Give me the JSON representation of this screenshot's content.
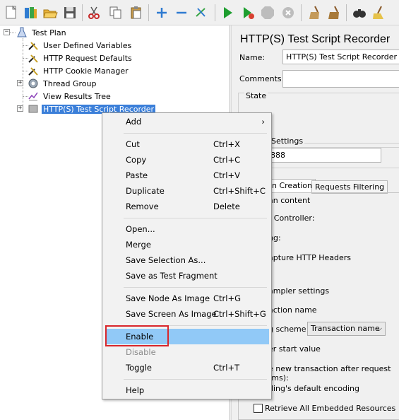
{
  "toolbar": {
    "buttons": [
      "new-icon",
      "templates-icon",
      "open-icon",
      "save-icon",
      "cut-icon",
      "copy-icon",
      "paste-icon",
      "expand-icon",
      "collapse-icon",
      "toggle-icon",
      "start-icon",
      "start-no-pauses-icon",
      "stop-icon",
      "shutdown-icon",
      "clear-icon",
      "clear-all-icon",
      "search-icon",
      "reset-search-icon"
    ]
  },
  "tree": {
    "root": "Test Plan",
    "items": [
      {
        "label": "User Defined Variables",
        "icon": "wrench-icon"
      },
      {
        "label": "HTTP Request Defaults",
        "icon": "wrench-icon"
      },
      {
        "label": "HTTP Cookie Manager",
        "icon": "wrench-icon"
      },
      {
        "label": "Thread Group",
        "icon": "gear-icon"
      },
      {
        "label": "View Results Tree",
        "icon": "graph-icon"
      },
      {
        "label": "HTTP(S) Test Script Recorder",
        "icon": "recorder-icon"
      }
    ]
  },
  "right_panel": {
    "title": "HTTP(S) Test Script Recorder",
    "name_label": "Name:",
    "name_value": "HTTP(S) Test Script Recorder",
    "comments_label": "Comments:",
    "state_label": "State",
    "settings_label": "Settings",
    "port_value": "888",
    "tab_creation": "n Creation",
    "tab_filtering": "Requests Filtering",
    "plan_content": "an content",
    "controller_label": "t Controller:",
    "grouping_label": "ng:",
    "capture_label": "apture HTTP Headers",
    "sampler_settings": "ampler settings",
    "transaction_name": "action name",
    "naming_scheme": "g scheme",
    "naming_scheme_value": "Transaction name",
    "counter_label": "er start value",
    "new_transaction": "e new transaction after request (ms):",
    "encoding_label": "ding's default encoding",
    "retrieve_label": "Retrieve All Embedded Resources"
  },
  "context_menu": {
    "add": "Add",
    "cut": "Cut",
    "cut_sc": "Ctrl+X",
    "copy": "Copy",
    "copy_sc": "Ctrl+C",
    "paste": "Paste",
    "paste_sc": "Ctrl+V",
    "duplicate": "Duplicate",
    "duplicate_sc": "Ctrl+Shift+C",
    "remove": "Remove",
    "remove_sc": "Delete",
    "open": "Open...",
    "merge": "Merge",
    "save_selection": "Save Selection As...",
    "save_fragment": "Save as Test Fragment",
    "save_node_image": "Save Node As Image",
    "save_node_image_sc": "Ctrl+G",
    "save_screen_image": "Save Screen As Image",
    "save_screen_image_sc": "Ctrl+Shift+G",
    "enable": "Enable",
    "disable": "Disable",
    "toggle": "Toggle",
    "toggle_sc": "Ctrl+T",
    "help": "Help"
  },
  "colors": {
    "selection": "#3b7fd9",
    "menu_highlight": "#91c9f7",
    "annotation_border": "#d9262b"
  }
}
